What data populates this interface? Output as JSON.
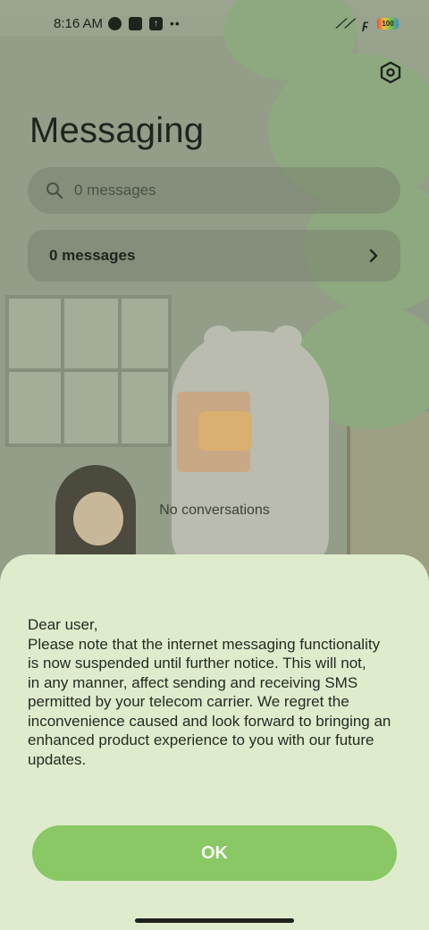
{
  "status_bar": {
    "time": "8:16 AM",
    "battery": "100",
    "icons_left": [
      "data-saver-icon",
      "square-icon",
      "upload-icon",
      "more-dots-icon"
    ],
    "icons_right": [
      "signal-icon",
      "wifi-icon",
      "battery-icon"
    ]
  },
  "header": {
    "title": "Messaging",
    "settings_icon": "settings-hexagon-icon"
  },
  "search": {
    "placeholder": "0 messages",
    "icon": "search-icon"
  },
  "messages_card": {
    "label": "0 messages",
    "icon": "chevron-right-icon"
  },
  "empty_state": {
    "text": "No conversations"
  },
  "dialog": {
    "message_lines": [
      "Dear user,",
      "Please note that the internet messaging functionality",
      "is now suspended until further notice. This will not,",
      "in any manner, affect sending and receiving SMS",
      "permitted by your telecom carrier. We regret the",
      "inconvenience caused and look forward to bringing an",
      "enhanced product experience to you with our future",
      "updates."
    ],
    "ok_label": "OK"
  },
  "colors": {
    "sheet_background": "#deeccd",
    "ok_button": "#8ac765",
    "ok_text": "#f4f9ef",
    "text_primary": "#1f241e"
  }
}
